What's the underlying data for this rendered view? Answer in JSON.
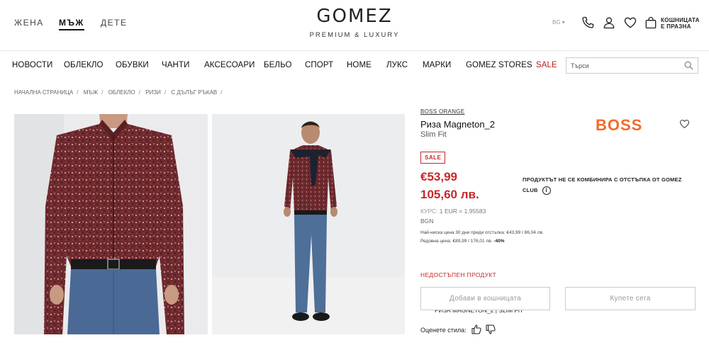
{
  "header": {
    "gender_tabs": [
      "ЖЕНА",
      "МЪЖ",
      "ДЕТЕ"
    ],
    "active_gender": "МЪЖ",
    "logo": "GOMEZ",
    "tagline": "PREMIUM & LUXURY",
    "language": "BG ▾",
    "cart_label_line1": "КОШНИЦАТА",
    "cart_label_line2": "Е ПРАЗНА",
    "icons": [
      "phone-icon",
      "user-icon",
      "heart-icon",
      "bag-icon"
    ]
  },
  "nav": {
    "items": [
      "НОВОСТИ",
      "ОБЛЕКЛО",
      "ОБУВКИ",
      "ЧАНТИ",
      "АКСЕСОАРИ",
      "БЕЛЬО",
      "СПОРТ",
      "HOME",
      "ЛУКС",
      "МАРКИ",
      "GOMEZ STORES",
      "SALE"
    ],
    "search_placeholder": "Търси"
  },
  "breadcrumb": [
    "НАЧАЛНА СТРАНИЦА",
    "МЪЖ",
    "ОБЛЕКЛО",
    "РИЗИ",
    "С ДЪЛЪГ РЪКАВ",
    "РИЗА MAGNETON_2 | SLIM FIT"
  ],
  "product": {
    "brand": "BOSS ORANGE",
    "brand_logo": "BOSS",
    "name": "Риза Magneton_2",
    "fit": "Slim Fit",
    "sale_badge": "SALE",
    "price_eur": "€53,99",
    "price_bgn": "105,60 лв.",
    "rate_label": "КУРС:",
    "rate_value": "1 EUR = 1.95583",
    "currency": "BGN",
    "lowest_price": "Най-ниска цена 30 дни преди отстъпка: €43,99 / 86,04 лв.",
    "regular_price_label": "Редовна цена: €89,99 / 176,01 лв.",
    "discount": "-40%",
    "club_note": "ПРОДУКТЪТ НЕ СЕ КОМБИНИРА С ОТСТЪПКА ОТ GOMEZ CLUB",
    "info_icon": "i",
    "availability": "НЕДОСТЪПЕН ПРОДУКТ",
    "add_to_cart": "Добави в кошницата",
    "buy_now": "Купете сега",
    "rate_style": "Оценете стила:"
  },
  "colors": {
    "sale_red": "#c62828",
    "boss_orange": "#f26b2a"
  }
}
